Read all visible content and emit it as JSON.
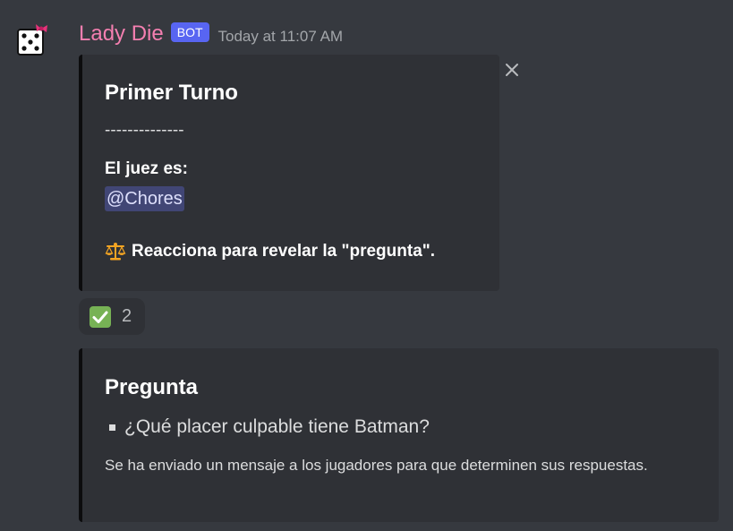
{
  "message": {
    "username": "Lady Die",
    "bot_tag": "BOT",
    "timestamp": "Today at 11:07 AM",
    "avatar_icon": "dice-with-pink-bow-icon"
  },
  "embed1": {
    "title": "Primer Turno",
    "divider": "--------------",
    "judge_label": "El juez es:",
    "mention": "@Chores",
    "reaction_prompt": "Reacciona para revelar la \"pregunta\".",
    "prompt_icon": "scales-icon",
    "close_icon": "close-icon"
  },
  "reaction": {
    "emoji": "white-check-mark-icon",
    "count": "2"
  },
  "embed2": {
    "title": "Pregunta",
    "question": "¿Qué placer culpable tiene Batman?",
    "description": "Se ha enviado un mensaje a los jugadores para que determinen sus respuestas."
  },
  "colors": {
    "background": "#36393f",
    "embed_background": "#2f3136",
    "username": "#f47fb0",
    "bot_tag": "#5865f2",
    "mention_bg": "#414675",
    "check_green": "#77b255"
  }
}
